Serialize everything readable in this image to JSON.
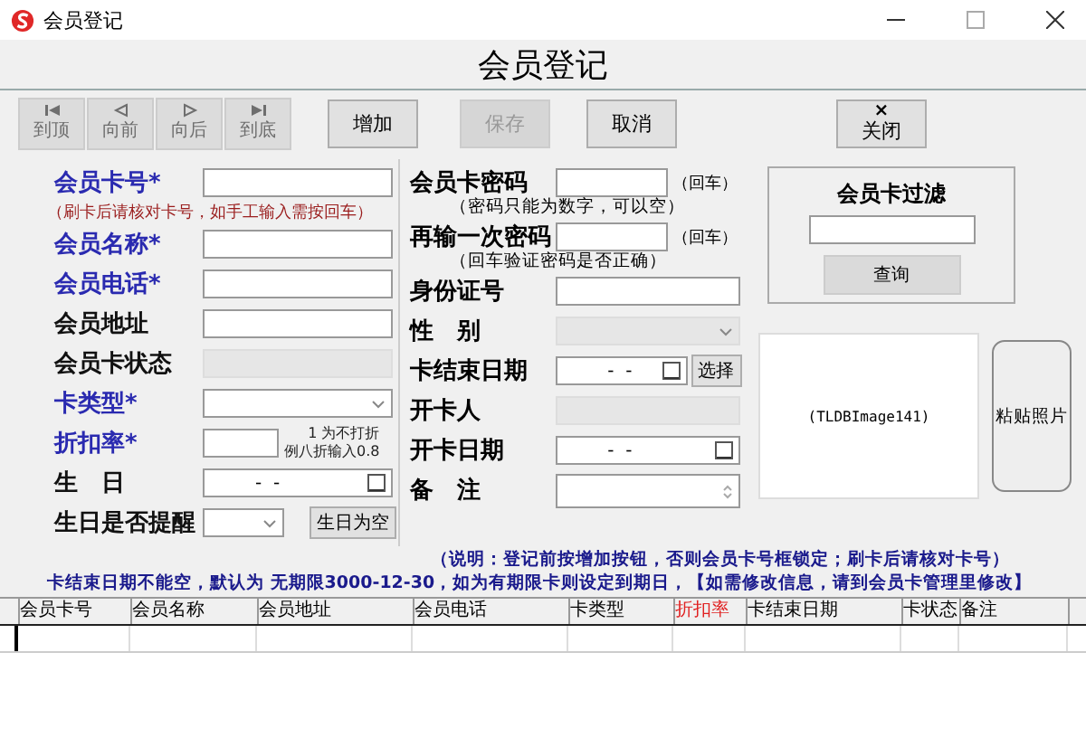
{
  "window": {
    "title": "会员登记"
  },
  "header": "会员登记",
  "nav_buttons": [
    {
      "kind": "first",
      "label": "到顶",
      "disabled": true
    },
    {
      "kind": "prev",
      "label": "向前",
      "disabled": true
    },
    {
      "kind": "next",
      "label": "向后",
      "disabled": true
    },
    {
      "kind": "last",
      "label": "到底",
      "disabled": true
    }
  ],
  "buttons": [
    {
      "label": "增加",
      "disabled": false
    },
    {
      "label": "保存",
      "disabled": true
    },
    {
      "label": "取消",
      "disabled": false
    }
  ],
  "close_button": {
    "icon": "×",
    "label": "关闭"
  },
  "left_fields": [
    {
      "kind": "text",
      "label": "会员卡号*",
      "required": true,
      "hint": "（刷卡后请核对卡号，如手工输入需按回车）"
    },
    {
      "kind": "text",
      "label": "会员名称*",
      "required": true
    },
    {
      "kind": "text",
      "label": "会员电话*",
      "required": true
    },
    {
      "kind": "text",
      "label": "会员地址",
      "required": false
    },
    {
      "kind": "disabled",
      "label": "会员卡状态",
      "required": false
    },
    {
      "kind": "select",
      "label": "卡类型*",
      "required": true
    },
    {
      "kind": "number",
      "label": "折扣率*",
      "required": true,
      "note": [
        "1 为不打折",
        "例八折输入0.8"
      ]
    },
    {
      "kind": "date",
      "label": "生　日",
      "required": false,
      "value": "-  -"
    },
    {
      "kind": "smallselect",
      "label": "生日是否提醒",
      "required": false,
      "button": "生日为空"
    }
  ],
  "mid_fields": [
    {
      "kind": "password",
      "label": "会员卡密码",
      "suffix": "（回车）",
      "hint": "（密码只能为数字，可以空）"
    },
    {
      "kind": "password",
      "label": "再输一次密码",
      "suffix": "（回车）",
      "hint": "（回车验证密码是否正确）"
    },
    {
      "kind": "text",
      "label": "身份证号"
    },
    {
      "kind": "select",
      "label": "性　别"
    },
    {
      "kind": "date",
      "label": "卡结束日期",
      "value": "-  -",
      "button": "选择"
    },
    {
      "kind": "disabled",
      "label": "开卡人"
    },
    {
      "kind": "date",
      "label": "开卡日期",
      "value": "-  -"
    },
    {
      "kind": "memo",
      "label": "备　注"
    }
  ],
  "filter": {
    "title": "会员卡过滤",
    "button": "查询"
  },
  "photo": {
    "caption": "(TLDBImage141)",
    "button": "粘贴照片"
  },
  "notes": [
    "（说明：登记前按增加按钮，否则会员卡号框锁定；刷卡后请核对卡号）",
    "卡结束日期不能空，默认为 无期限3000-12-30，如为有期限卡则设定到期日，【如需修改信息，请到会员卡管理里修改】"
  ],
  "table": {
    "columns": [
      {
        "label": "会员卡号",
        "color": "#000000"
      },
      {
        "label": "会员名称",
        "color": "#000000"
      },
      {
        "label": "会员地址",
        "color": "#000000"
      },
      {
        "label": "会员电话",
        "color": "#000000"
      },
      {
        "label": "卡类型",
        "color": "#000000"
      },
      {
        "label": "折扣率",
        "color": "#e02020"
      },
      {
        "label": "卡结束日期",
        "color": "#000000"
      },
      {
        "label": "卡状态",
        "color": "#000000"
      },
      {
        "label": "备注",
        "color": "#000000"
      }
    ]
  }
}
